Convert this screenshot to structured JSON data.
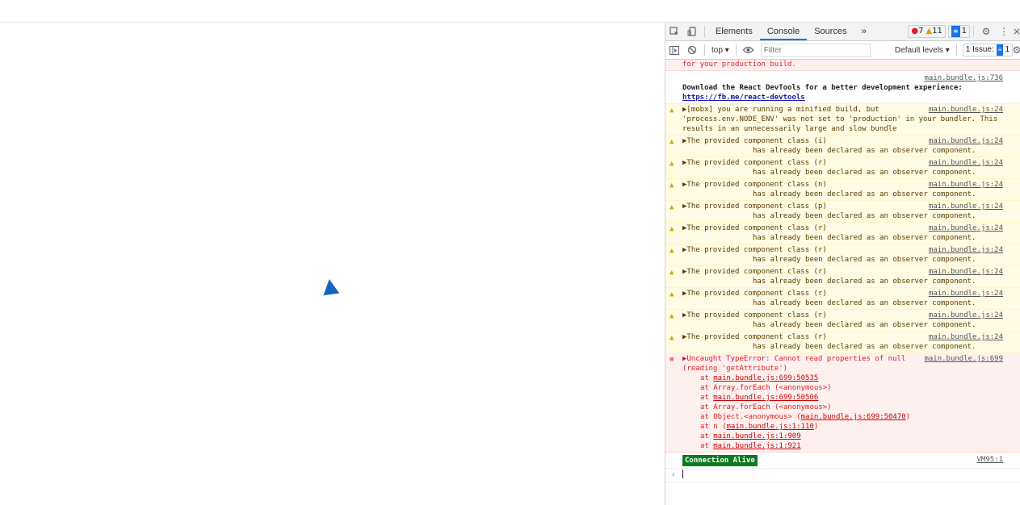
{
  "devtools": {
    "tabs": [
      "Elements",
      "Console",
      "Sources"
    ],
    "more": "»",
    "error_count": "7",
    "warning_count": "11",
    "message_count": "1",
    "toolbar": {
      "context": "top ▾",
      "filter_placeholder": "Filter",
      "levels": "Default levels ▾",
      "issues": "1 Issue:",
      "issues_count": "1"
    },
    "console": {
      "prod_text": "for your production build.",
      "devtools_src": "main.bundle.js:736",
      "devtools_text": "Download the React DevTools for a better development experience: ",
      "devtools_link": "https://fb.me/react-devtools",
      "mobx_src": "main.bundle.js:24",
      "mobx_text": "▶[mobx] you are running a minified build, but 'process.env.NODE_ENV' was not set to 'production' in your bundler. This results in an unnecessarily large and slow bundle",
      "observer_warnings": [
        {
          "line1": "▶The provided component class (i)",
          "line2": "has already been declared as an observer component.",
          "src": "main.bundle.js:24"
        },
        {
          "line1": "▶The provided component class (r)",
          "line2": "has already been declared as an observer component.",
          "src": "main.bundle.js:24"
        },
        {
          "line1": "▶The provided component class (n)",
          "line2": "has already been declared as an observer component.",
          "src": "main.bundle.js:24"
        },
        {
          "line1": "▶The provided component class (p)",
          "line2": "has already been declared as an observer component.",
          "src": "main.bundle.js:24"
        },
        {
          "line1": "▶The provided component class (r)",
          "line2": "has already been declared as an observer component.",
          "src": "main.bundle.js:24"
        },
        {
          "line1": "▶The provided component class (r)",
          "line2": "has already been declared as an observer component.",
          "src": "main.bundle.js:24"
        },
        {
          "line1": "▶The provided component class (r)",
          "line2": "has already been declared as an observer component.",
          "src": "main.bundle.js:24"
        },
        {
          "line1": "▶The provided component class (r)",
          "line2": "has already been declared as an observer component.",
          "src": "main.bundle.js:24"
        },
        {
          "line1": "▶The provided component class (r)",
          "line2": "has already been declared as an observer component.",
          "src": "main.bundle.js:24"
        },
        {
          "line1": "▶The provided component class (r)",
          "line2": "has already been declared as an observer component.",
          "src": "main.bundle.js:24"
        }
      ],
      "error": {
        "text": "▶Uncaught TypeError: Cannot read properties of null (reading 'getAttribute')",
        "src": "main.bundle.js:699",
        "stack": [
          {
            "pre": "at ",
            "link": "main.bundle.js:699:50535",
            "post": ""
          },
          {
            "pre": "at Array.forEach (<anonymous>)",
            "link": "",
            "post": ""
          },
          {
            "pre": "at ",
            "link": "main.bundle.js:699:50506",
            "post": ""
          },
          {
            "pre": "at Array.forEach (<anonymous>)",
            "link": "",
            "post": ""
          },
          {
            "pre": "at Object.<anonymous> (",
            "link": "main.bundle.js:699:50470",
            "post": ")"
          },
          {
            "pre": "at n (",
            "link": "main.bundle.js:1:110",
            "post": ")"
          },
          {
            "pre": "at ",
            "link": "main.bundle.js:1:909",
            "post": ""
          },
          {
            "pre": "at ",
            "link": "main.bundle.js:1:921",
            "post": ""
          }
        ]
      },
      "alive_label": "Connection Alive",
      "alive_src": "VM95:1",
      "prompt": "›"
    }
  }
}
